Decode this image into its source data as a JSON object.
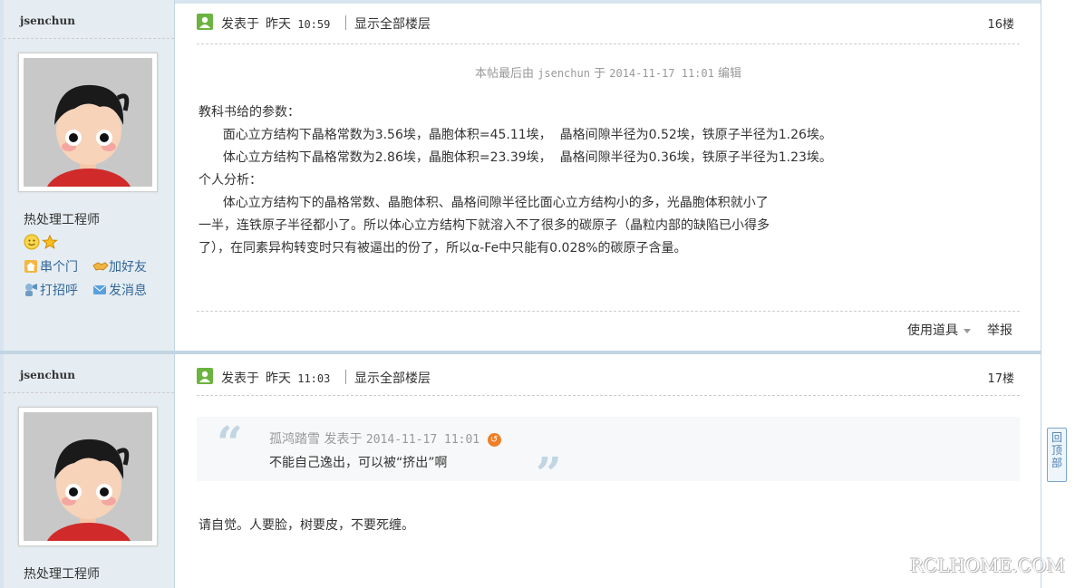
{
  "posts": [
    {
      "author": "jsenchun",
      "group_title": "热处理工程师",
      "actions": {
        "visit": "串个门",
        "add_friend": "加好友",
        "greet": "打招呼",
        "message": "发消息"
      },
      "posted_label": "发表于",
      "posted_day": "昨天",
      "posted_time": "10:59",
      "show_all": "显示全部楼层",
      "floor": "16楼",
      "edit_note": {
        "prefix": "本帖最后由",
        "user": "jsenchun",
        "at": "于",
        "datetime": "2014-11-17 11:01",
        "suffix": "编辑"
      },
      "body_lines": [
        "教科书给的参数：",
        "      面心立方结构下晶格常数为3.56埃，晶胞体积=45.11埃，  晶格间隙半径为0.52埃，铁原子半径为1.26埃。",
        "      体心立方结构下晶格常数为2.86埃，晶胞体积=23.39埃，  晶格间隙半径为0.36埃，铁原子半径为1.23埃。",
        "个人分析：",
        "      体心立方结构下的晶格常数、晶胞体积、晶格间隙半径比面心立方结构小的多，光晶胞体积就小了",
        "一半，连铁原子半径都小了。所以体心立方结构下就溶入不了很多的碳原子（晶粒内部的缺陷已小得多",
        "了），在同素异构转变时只有被逼出的份了，所以α-Fe中只能有0.028%的碳原子含量。"
      ],
      "tools_label": "使用道具",
      "report_label": "举报"
    },
    {
      "author": "jsenchun",
      "group_title": "热处理工程师",
      "posted_label": "发表于",
      "posted_day": "昨天",
      "posted_time": "11:03",
      "show_all": "显示全部楼层",
      "floor": "17楼",
      "quote": {
        "author": "孤鸿踏雪",
        "posted_label": "发表于",
        "datetime": "2014-11-17 11:01",
        "text": "不能自己逸出，可以被“挤出”啊"
      },
      "body": "请自觉。人要脸，树要皮，不要死缠。"
    }
  ],
  "back_to_top": [
    "回",
    "顶",
    "部"
  ],
  "watermark": "RCLHOME.COM"
}
